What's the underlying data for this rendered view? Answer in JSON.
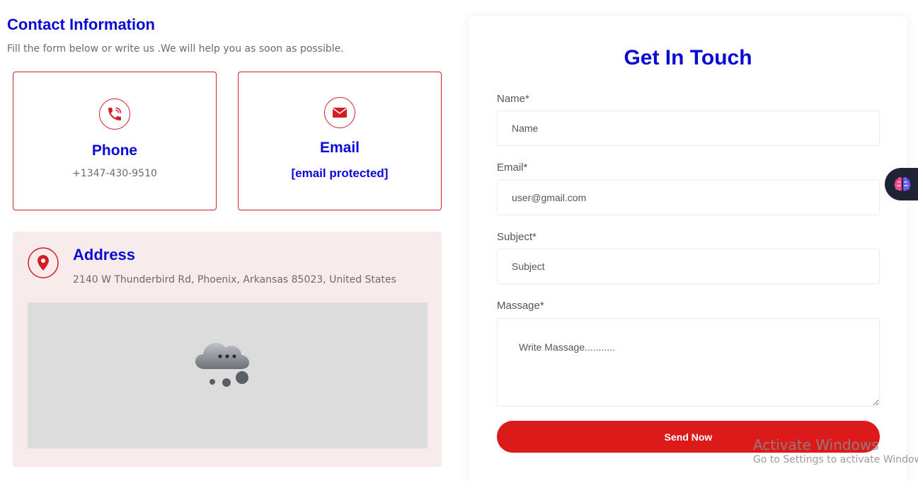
{
  "contact": {
    "title": "Contact Information",
    "subtitle": "Fill the form below or write us .We will help you as soon as possible."
  },
  "phone_card": {
    "title": "Phone",
    "value": "+1347-430-9510",
    "icon": "phone-icon"
  },
  "email_card": {
    "title": "Email",
    "value": "[email protected]",
    "icon": "envelope-icon"
  },
  "address": {
    "title": "Address",
    "text": "2140 W Thunderbird Rd, Phoenix, Arkansas 85023, United States",
    "icon": "map-pin-icon"
  },
  "form": {
    "title": "Get In Touch",
    "name_label": "Name*",
    "name_placeholder": "Name",
    "email_label": "Email*",
    "email_placeholder": "user@gmail.com",
    "subject_label": "Subject*",
    "subject_placeholder": "Subject",
    "message_label": "Massage*",
    "message_placeholder": "Write Massage...........",
    "submit_label": "Send Now"
  },
  "watermark": {
    "title": "Activate Windows",
    "subtitle": "Go to Settings to activate Windows."
  },
  "colors": {
    "accent_blue": "#0a0ad6",
    "accent_red": "#dc1a1a",
    "address_bg": "#f8ebeb"
  }
}
